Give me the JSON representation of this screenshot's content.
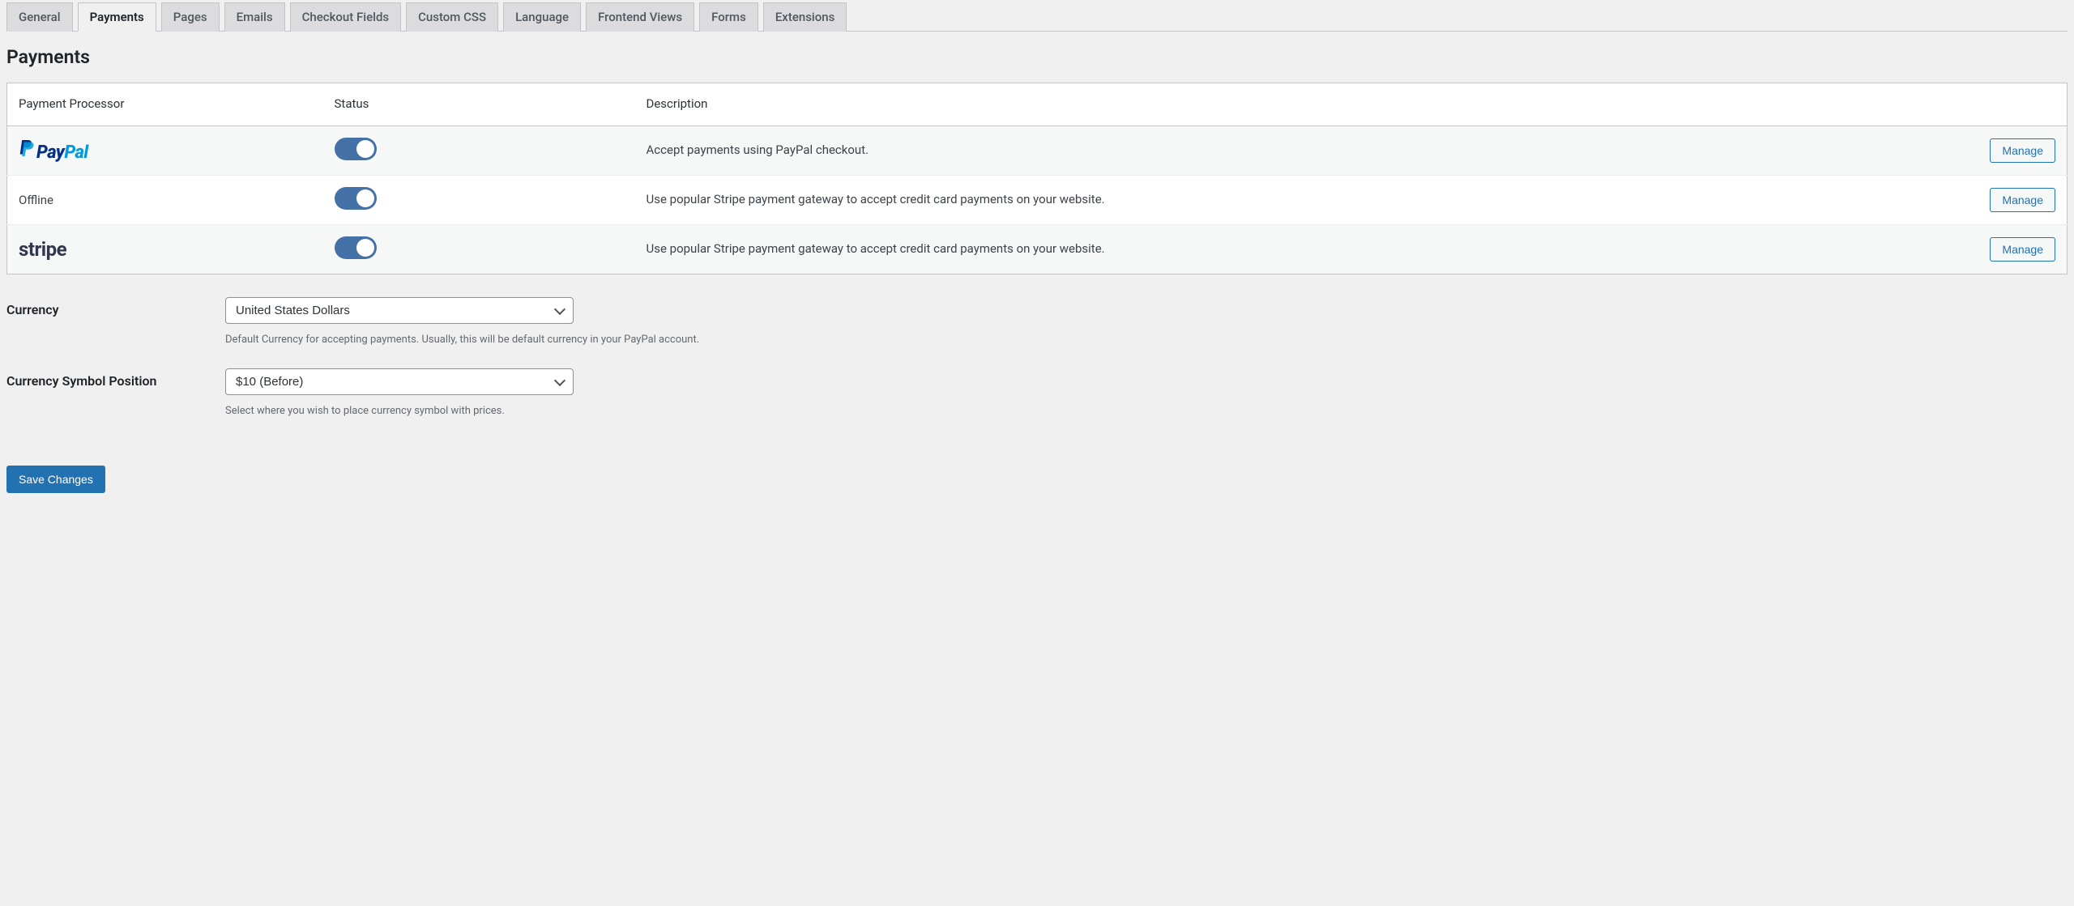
{
  "tabs": [
    {
      "label": "General"
    },
    {
      "label": "Payments"
    },
    {
      "label": "Pages"
    },
    {
      "label": "Emails"
    },
    {
      "label": "Checkout Fields"
    },
    {
      "label": "Custom CSS"
    },
    {
      "label": "Language"
    },
    {
      "label": "Frontend Views"
    },
    {
      "label": "Forms"
    },
    {
      "label": "Extensions"
    }
  ],
  "active_tab": "Payments",
  "page_title": "Payments",
  "table": {
    "headers": {
      "processor": "Payment Processor",
      "status": "Status",
      "description": "Description"
    },
    "rows": [
      {
        "name": "PayPal",
        "enabled": true,
        "description": "Accept payments using PayPal checkout.",
        "manage_label": "Manage"
      },
      {
        "name": "Offline",
        "enabled": true,
        "description": "Use popular Stripe payment gateway to accept credit card payments on your website.",
        "manage_label": "Manage"
      },
      {
        "name": "stripe",
        "enabled": true,
        "description": "Use popular Stripe payment gateway to accept credit card payments on your website.",
        "manage_label": "Manage"
      }
    ]
  },
  "currency": {
    "label": "Currency",
    "value": "United States Dollars",
    "help": "Default Currency for accepting payments. Usually, this will be default currency in your PayPal account."
  },
  "symbol_position": {
    "label": "Currency Symbol Position",
    "value": "$10 (Before)",
    "help": "Select where you wish to place currency symbol with prices."
  },
  "save_label": "Save Changes"
}
